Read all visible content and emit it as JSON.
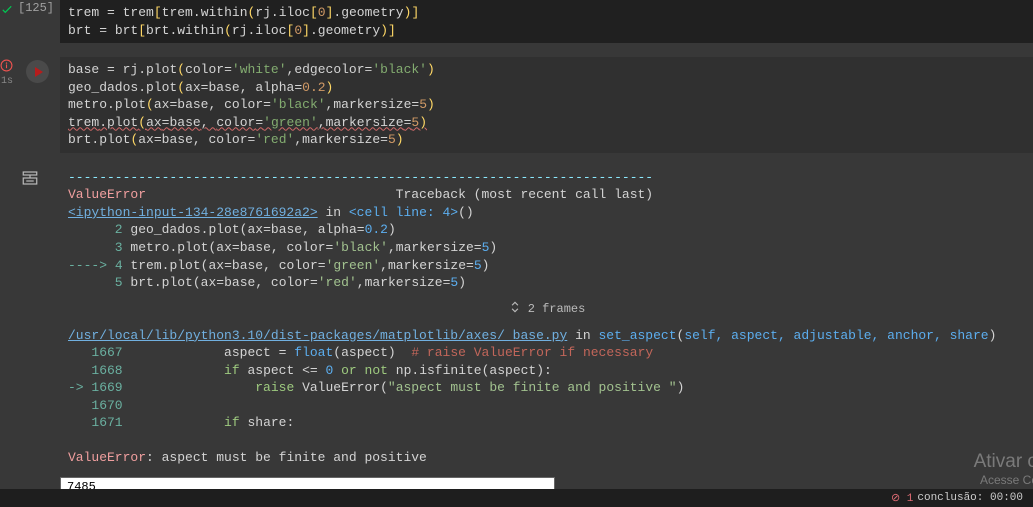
{
  "cell0": {
    "exec_label": "[125]",
    "line1": {
      "v1": "trem",
      "op1": " = ",
      "v2": "trem",
      "br1": "[",
      "v3": "trem",
      "dot1": ".",
      "fn1": "within",
      "p1": "(",
      "v4": "rj",
      "dot2": ".",
      "v5": "iloc",
      "br2": "[",
      "n1": "0",
      "br3": "]",
      "dot3": ".",
      "v6": "geometry",
      "p2": ")",
      "br4": "]"
    },
    "line2": {
      "v1": "brt",
      "op1": " = ",
      "v2": "brt",
      "br1": "[",
      "v3": "brt",
      "dot1": ".",
      "fn1": "within",
      "p1": "(",
      "v4": "rj",
      "dot2": ".",
      "v5": "iloc",
      "br2": "[",
      "n1": "0",
      "br3": "]",
      "dot3": ".",
      "v6": "geometry",
      "p2": ")",
      "br4": "]"
    }
  },
  "cell1": {
    "status_time": "1s",
    "l1": {
      "v1": "base",
      "op": " = ",
      "v2": "rj",
      "dot": ".",
      "fn": "plot",
      "p1": "(",
      "a1": "color",
      "eq": "=",
      "s1": "'white'",
      "c": ",",
      "a2": "edgecolor",
      "eq2": "=",
      "s2": "'black'",
      "p2": ")"
    },
    "l2": {
      "v1": "geo_dados",
      "dot": ".",
      "fn": "plot",
      "p1": "(",
      "a1": "ax",
      "eq": "=",
      "v2": "base",
      "c": ", ",
      "a2": "alpha",
      "eq2": "=",
      "n": "0.2",
      "p2": ")"
    },
    "l3": {
      "v1": "metro",
      "dot": ".",
      "fn": "plot",
      "p1": "(",
      "a1": "ax",
      "eq": "=",
      "v2": "base",
      "c": ", ",
      "a2": "color",
      "eq2": "=",
      "s": "'black'",
      "c2": ",",
      "a3": "markersize",
      "eq3": "=",
      "n": "5",
      "p2": ")"
    },
    "l4": {
      "v1": "trem",
      "dot": ".",
      "fn": "plot",
      "p1": "(",
      "a1": "ax",
      "eq": "=",
      "v2": "base",
      "c": ", ",
      "a2": "color",
      "eq2": "=",
      "s": "'green'",
      "c2": ",",
      "a3": "markersize",
      "eq3": "=",
      "n": "5",
      "p2": ")"
    },
    "l5": {
      "v1": "brt",
      "dot": ".",
      "fn": "plot",
      "p1": "(",
      "a1": "ax",
      "eq": "=",
      "v2": "base",
      "c": ", ",
      "a2": "color",
      "eq2": "=",
      "s": "'red'",
      "c2": ",",
      "a3": "markersize",
      "eq3": "=",
      "n": "5",
      "p2": ")"
    }
  },
  "output": {
    "dashes": "---------------------------------------------------------------------------",
    "err_header": {
      "name": "ValueError",
      "spacer": "                                ",
      "rest": "Traceback (most recent call last)"
    },
    "frame1": {
      "link": "<ipython-input-134-28e8761692a2>",
      "in": " in ",
      "loc": "<cell line: 4>",
      "tail": "()"
    },
    "tl1": {
      "num": "      2 ",
      "body_v": "geo_dados",
      "body_dot": ".",
      "body_fn": "plot",
      "body_p1": "(",
      "body_a1": "ax",
      "body_eq": "=",
      "body_v2": "base",
      "body_c": ", ",
      "body_a2": "alpha",
      "body_eq2": "=",
      "body_n": "0.2",
      "body_p2": ")"
    },
    "tl2": {
      "num": "      3 ",
      "body_v": "metro",
      "body_dot": ".",
      "body_fn": "plot",
      "body_p1": "(",
      "body_a1": "ax",
      "body_eq": "=",
      "body_v2": "base",
      "body_c": ", ",
      "body_a2": "color",
      "body_eq2": "=",
      "body_s": "'black'",
      "body_c2": ",",
      "body_a3": "markersize",
      "body_eq3": "=",
      "body_n": "5",
      "body_p2": ")"
    },
    "tl3": {
      "arrow": "----> ",
      "num": "4 ",
      "body_v": "trem",
      "body_dot": ".",
      "body_fn": "plot",
      "body_p1": "(",
      "body_a1": "ax",
      "body_eq": "=",
      "body_v2": "base",
      "body_c": ", ",
      "body_a2": "color",
      "body_eq2": "=",
      "body_s": "'green'",
      "body_c2": ",",
      "body_a3": "markersize",
      "body_eq3": "=",
      "body_n": "5",
      "body_p2": ")"
    },
    "tl4": {
      "num": "      5 ",
      "body_v": "brt",
      "body_dot": ".",
      "body_fn": "plot",
      "body_p1": "(",
      "body_a1": "ax",
      "body_eq": "=",
      "body_v2": "base",
      "body_c": ", ",
      "body_a2": "color",
      "body_eq2": "=",
      "body_s": "'red'",
      "body_c2": ",",
      "body_a3": "markersize",
      "body_eq3": "=",
      "body_n": "5",
      "body_p2": ")"
    },
    "frames_label": "2 frames",
    "frame2": {
      "link": "/usr/local/lib/python3.10/dist-packages/matplotlib/axes/_base.py",
      "in": " in ",
      "fn": "set_aspect",
      "p1": "(",
      "args": "self, aspect, adjustable, anchor, share",
      "p2": ")"
    },
    "sl1": {
      "num": "   1667 ",
      "indent": "            ",
      "v": "aspect",
      "eq": " = ",
      "fn": "float",
      "p1": "(",
      "arg": "aspect",
      "p2": ")",
      "sp": "  ",
      "cmt": "# raise ValueError if necessary"
    },
    "sl2": {
      "num": "   1668 ",
      "indent": "            ",
      "kw1": "if",
      "sp1": " ",
      "v1": "aspect",
      "op1": " <= ",
      "n1": "0",
      "sp2": " ",
      "kw2": "or",
      "sp3": " ",
      "kw3": "not",
      "sp4": " ",
      "v2": "np",
      "dot": ".",
      "fn": "isfinite",
      "p1": "(",
      "arg": "aspect",
      "p2": ")",
      "colon": ":"
    },
    "sl3": {
      "arrow": "-> ",
      "num": "1669 ",
      "indent": "                ",
      "kw": "raise",
      "sp": " ",
      "exc": "ValueError",
      "p1": "(",
      "s": "\"aspect must be finite and positive \"",
      "p2": ")"
    },
    "sl4": {
      "num": "   1670 "
    },
    "sl5": {
      "num": "   1671 ",
      "indent": "            ",
      "kw1": "if",
      "sp1": " ",
      "v": "share",
      "colon": ":"
    },
    "final": {
      "name": "ValueError",
      "msg": ": aspect must be finite and positive "
    },
    "axis_tick": "7485"
  },
  "watermark": {
    "l1": "Ativar o",
    "l2": "Acesse Co"
  },
  "statusbar": {
    "err": "⊘ 1",
    "time": "conclusão: 00:00"
  }
}
